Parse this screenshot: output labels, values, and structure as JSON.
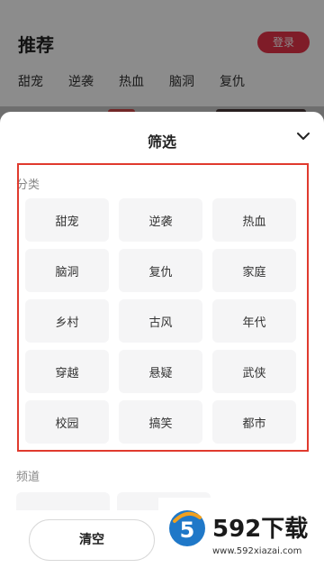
{
  "background": {
    "title": "推荐",
    "login_label": "登录",
    "categories": [
      "甜宠",
      "逆袭",
      "热血",
      "脑洞",
      "复仇"
    ]
  },
  "sheet": {
    "title": "筛选",
    "category_label": "分类",
    "categories": [
      "甜宠",
      "逆袭",
      "热血",
      "脑洞",
      "复仇",
      "家庭",
      "乡村",
      "古风",
      "年代",
      "穿越",
      "悬疑",
      "武侠",
      "校园",
      "搞笑",
      "都市"
    ],
    "channel_label": "频道",
    "clear_label": "清空"
  },
  "watermark": {
    "brand": "592下载",
    "url": "www.592xiazai.com"
  },
  "colors": {
    "accent": "#e8334a",
    "highlight": "#e03a2e"
  }
}
